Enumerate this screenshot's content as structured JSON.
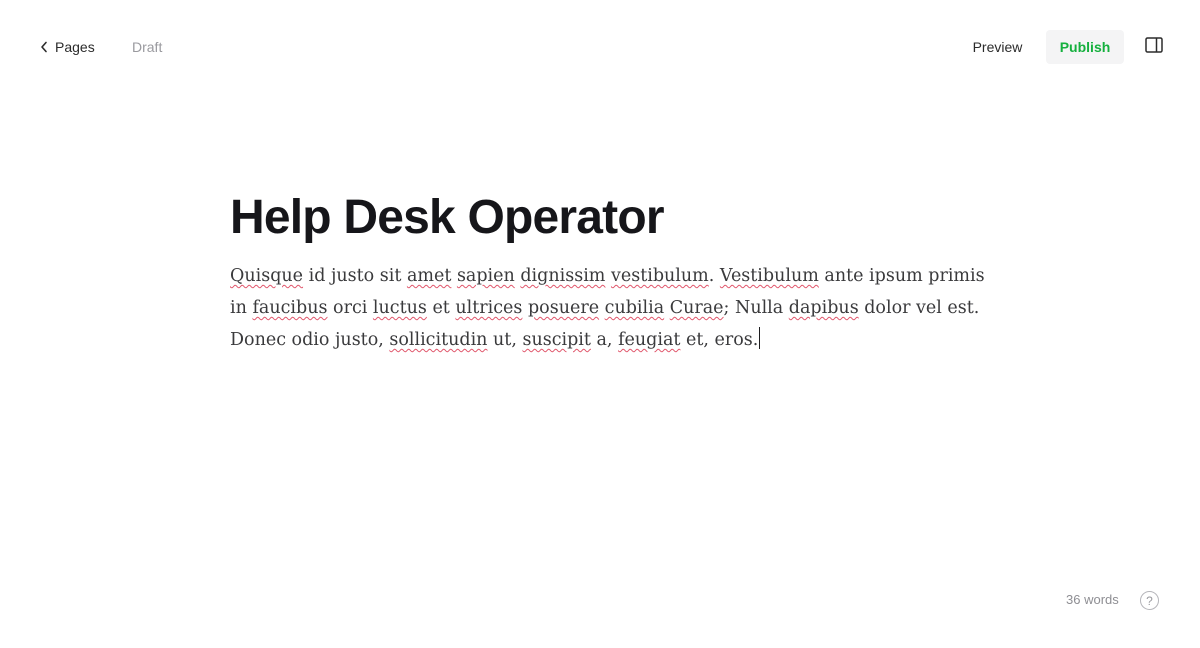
{
  "header": {
    "back_label": "Pages",
    "status": "Draft",
    "preview_label": "Preview",
    "publish_label": "Publish",
    "icons": {
      "back": "chevron-left-icon",
      "sidebar_toggle": "sidebar-panel-icon"
    }
  },
  "document": {
    "title": "Help Desk Operator",
    "body_segments": [
      {
        "text": "Quisque",
        "misspelled": true
      },
      {
        "text": " id justo sit ",
        "misspelled": false
      },
      {
        "text": "amet",
        "misspelled": true
      },
      {
        "text": " ",
        "misspelled": false
      },
      {
        "text": "sapien",
        "misspelled": true
      },
      {
        "text": " ",
        "misspelled": false
      },
      {
        "text": "dignissim",
        "misspelled": true
      },
      {
        "text": " ",
        "misspelled": false
      },
      {
        "text": "vestibulum",
        "misspelled": true
      },
      {
        "text": ". ",
        "misspelled": false
      },
      {
        "text": "Vestibulum",
        "misspelled": true
      },
      {
        "text": " ante ipsum primis in ",
        "misspelled": false
      },
      {
        "text": "faucibus",
        "misspelled": true
      },
      {
        "text": " orci ",
        "misspelled": false
      },
      {
        "text": "luctus",
        "misspelled": true
      },
      {
        "text": " et ",
        "misspelled": false
      },
      {
        "text": "ultrices",
        "misspelled": true
      },
      {
        "text": " ",
        "misspelled": false
      },
      {
        "text": "posuere",
        "misspelled": true
      },
      {
        "text": " ",
        "misspelled": false
      },
      {
        "text": "cubilia",
        "misspelled": true
      },
      {
        "text": " ",
        "misspelled": false
      },
      {
        "text": "Curae",
        "misspelled": true
      },
      {
        "text": "; Nulla ",
        "misspelled": false
      },
      {
        "text": "dapibus",
        "misspelled": true
      },
      {
        "text": " dolor vel est. Donec odio justo, ",
        "misspelled": false
      },
      {
        "text": "sollicitudin",
        "misspelled": true
      },
      {
        "text": " ut, ",
        "misspelled": false
      },
      {
        "text": "suscipit",
        "misspelled": true
      },
      {
        "text": " a, ",
        "misspelled": false
      },
      {
        "text": "feugiat",
        "misspelled": true
      },
      {
        "text": " et, eros.",
        "misspelled": false
      }
    ]
  },
  "footer": {
    "word_count": "36 words",
    "help_label": "?",
    "help_icon": "help-circle-icon"
  },
  "colors": {
    "accent_publish": "#15b03e",
    "spellcheck_underline": "#e0566b",
    "muted_text": "#9a9a9f"
  }
}
